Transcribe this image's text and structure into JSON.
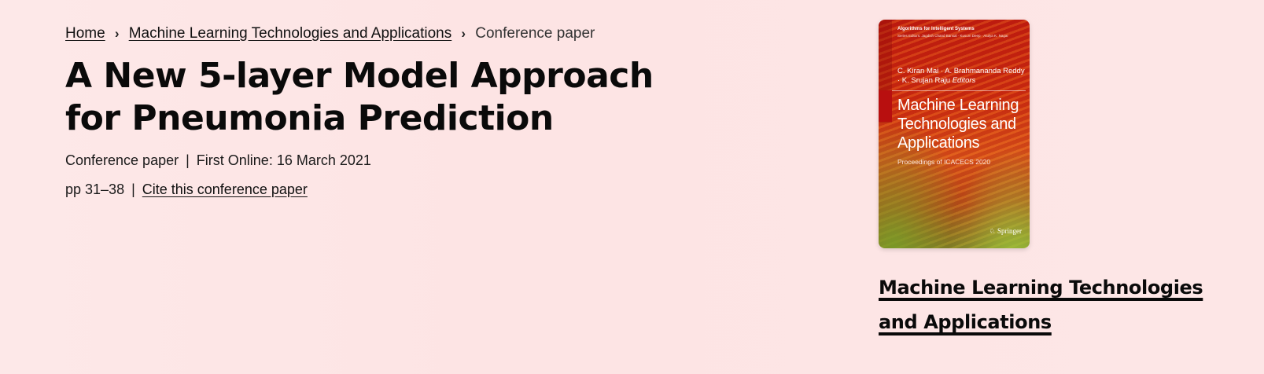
{
  "breadcrumb": {
    "home": "Home",
    "book": "Machine Learning Technologies and Applications",
    "current": "Conference paper",
    "separator": "›"
  },
  "article": {
    "title": "A New 5-layer Model Approach for Pneumonia Prediction",
    "type": "Conference paper",
    "first_online": "First Online: 16 March 2021",
    "pages": "pp 31–38",
    "cite_label": "Cite this conference paper",
    "divider": "|"
  },
  "book": {
    "cover": {
      "series": "Algorithms for Intelligent Systems",
      "series_editors": "Series Editors: Jagdish Chand Bansal · Kusum Deep · Atulya K. Nagar",
      "editors_names": "C. Kiran Mai · A. Brahmananda Reddy · K. Srujan Raju",
      "editors_suffix": "Editors",
      "title": "Machine Learning Technologies and Applications",
      "subtitle": "Proceedings of ICACECS 2020",
      "publisher": "Springer",
      "colors": {
        "primary": "#c01a10",
        "accent": "#6f8a2a"
      }
    },
    "title_link": "Machine Learning Technologies and Applications"
  },
  "colors": {
    "background": "#fde6e6",
    "text": "#111111"
  }
}
